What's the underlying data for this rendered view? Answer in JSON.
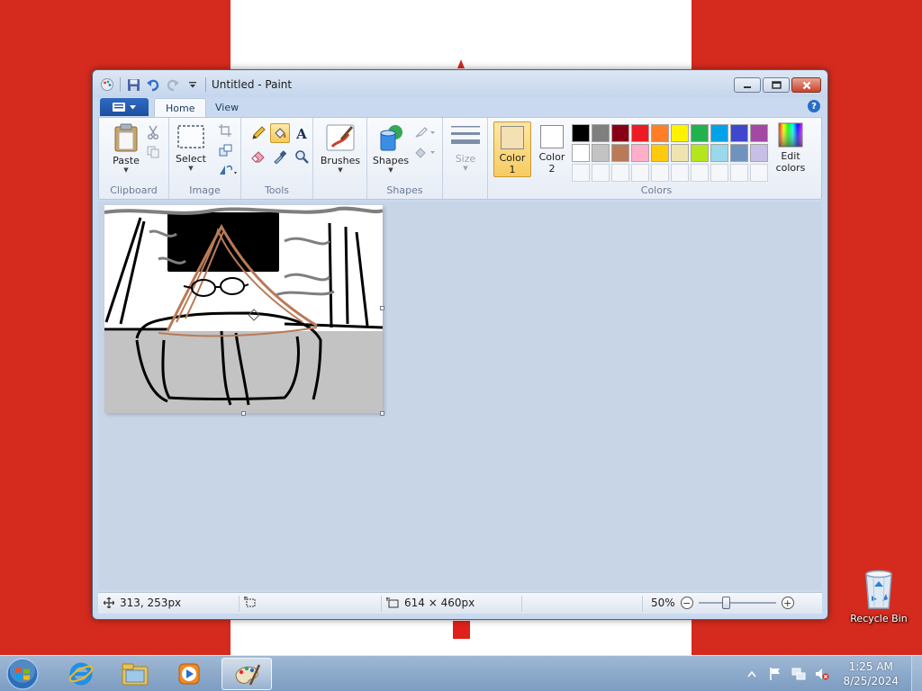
{
  "window": {
    "title": "Untitled - Paint"
  },
  "ribbon": {
    "file_menu_label": "",
    "tabs": [
      {
        "label": "Home",
        "active": true
      },
      {
        "label": "View",
        "active": false
      }
    ],
    "groups": {
      "clipboard": {
        "label": "Clipboard",
        "paste": "Paste"
      },
      "image": {
        "label": "Image",
        "select": "Select"
      },
      "tools": {
        "label": "Tools"
      },
      "brushes": {
        "label": "Brushes"
      },
      "shapes": {
        "label": "Shapes",
        "shapes_btn": "Shapes"
      },
      "size": {
        "label": "Size"
      },
      "colors": {
        "label": "Colors",
        "color1_line1": "Color",
        "color1_line2": "1",
        "color2_line1": "Color",
        "color2_line2": "2",
        "edit_line1": "Edit",
        "edit_line2": "colors",
        "color1_value": "#f3e0b3",
        "color2_value": "#ffffff",
        "palette_row1": [
          "#000000",
          "#7f7f7f",
          "#880015",
          "#ed1c24",
          "#ff7f27",
          "#fff200",
          "#22b14c",
          "#00a2e8",
          "#3f48cc",
          "#a349a4"
        ],
        "palette_row2": [
          "#ffffff",
          "#c3c3c3",
          "#b97a57",
          "#ffaec9",
          "#ffc90e",
          "#efe4b0",
          "#b5e61d",
          "#99d9ea",
          "#7092be",
          "#c8bfe7"
        ]
      }
    }
  },
  "status": {
    "cursor_pos": "313, 253px",
    "selection_size": "",
    "image_size": "614 × 460px",
    "zoom": "50%",
    "zoom_value": 50
  },
  "desktop": {
    "recycle_bin_label": "Recycle Bin"
  },
  "taskbar": {
    "time": "1:25 AM",
    "date": "8/25/2024"
  }
}
